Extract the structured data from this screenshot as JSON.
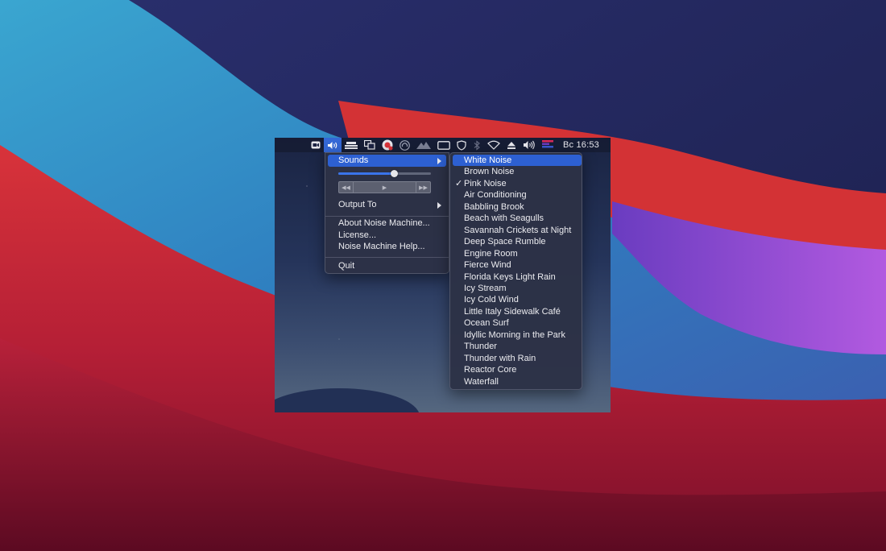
{
  "menubar": {
    "icons": [
      "zoom-icon",
      "speaker-wave-icon",
      "stack-icon",
      "windows-icon",
      "record-icon",
      "headphones-icon",
      "mountain-icon",
      "display-icon",
      "shield-icon",
      "bluetooth-icon",
      "wifi-icon",
      "eject-icon",
      "volume-icon",
      "flag-icon"
    ],
    "clock": "Вс 16:53"
  },
  "menu": {
    "sounds_label": "Sounds",
    "volume_level": 0.6,
    "output_label": "Output To",
    "about_label": "About Noise Machine...",
    "license_label": "License...",
    "help_label": "Noise Machine Help...",
    "quit_label": "Quit"
  },
  "sounds": {
    "items": [
      "White Noise",
      "Brown Noise",
      "Pink Noise",
      "Air Conditioning",
      "Babbling Brook",
      "Beach with Seagulls",
      "Savannah Crickets at Night",
      "Deep Space Rumble",
      "Engine Room",
      "Fierce Wind",
      "Florida Keys Light Rain",
      "Icy Stream",
      "Icy Cold Wind",
      "Little Italy Sidewalk Café",
      "Ocean Surf",
      "Idyllic Morning in the Park",
      "Thunder",
      "Thunder with Rain",
      "Reactor Core",
      "Waterfall"
    ],
    "highlighted": "White Noise",
    "checked": "Pink Noise",
    "check_mark": "✓"
  },
  "colors": {
    "highlight": "#2d60d2",
    "menu_bg": "#2c3246"
  }
}
